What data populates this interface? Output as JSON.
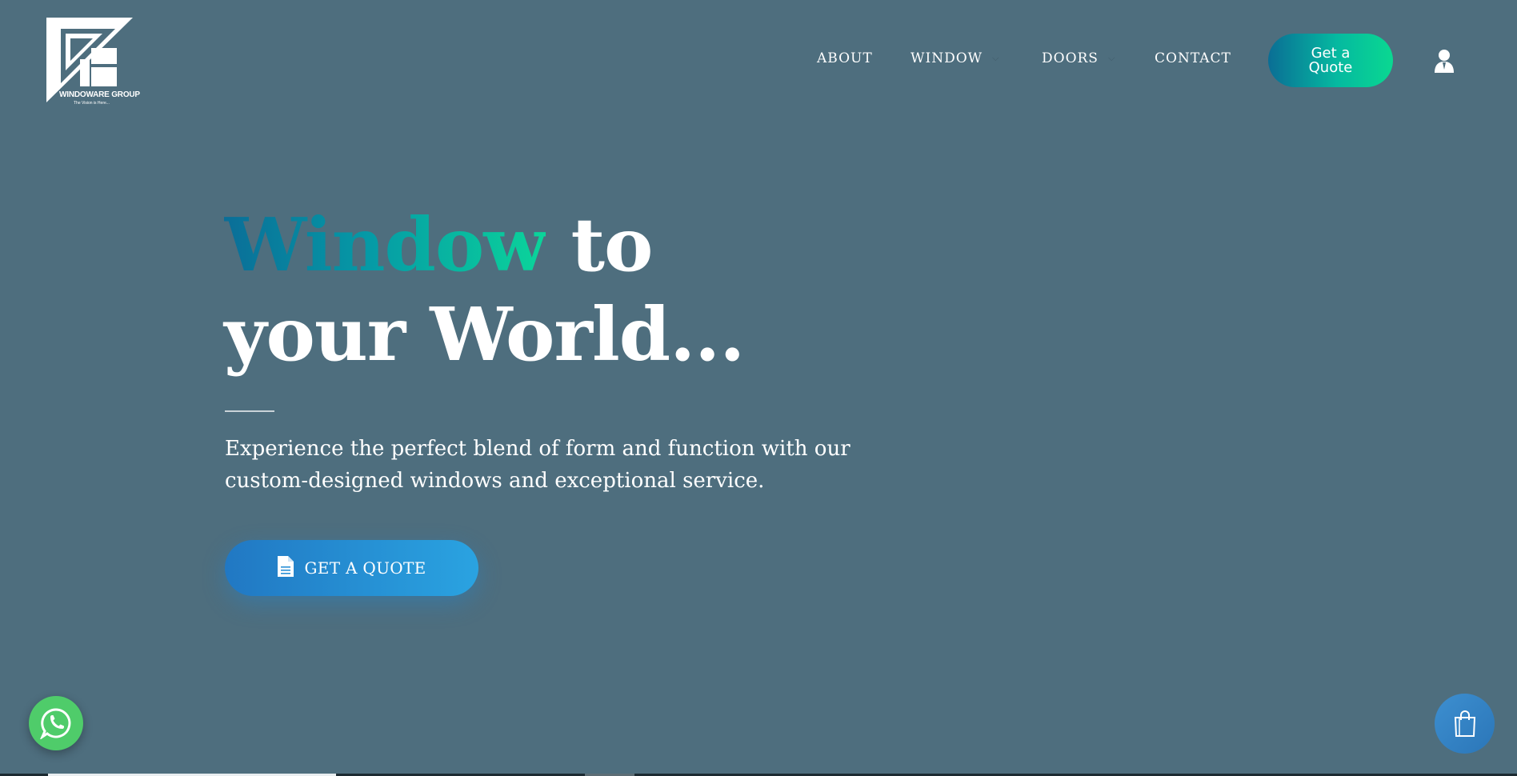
{
  "brand": {
    "name": "WINDOWARE GROUP",
    "tagline": "The Vision is Here..."
  },
  "nav": {
    "items": [
      {
        "label": "ABOUT",
        "has_dropdown": false
      },
      {
        "label": "WINDOW",
        "has_dropdown": true
      },
      {
        "label": "DOORS",
        "has_dropdown": true
      },
      {
        "label": "CONTACT",
        "has_dropdown": false
      }
    ],
    "quote_button": {
      "line1": "Get a",
      "line2": "Quote"
    },
    "user_icon": "user-icon"
  },
  "hero": {
    "title_highlight": "Window",
    "title_rest_line1": " to",
    "title_line2": "your World...",
    "subtitle": "Experience the perfect blend of form and function with our custom-designed windows and exceptional service.",
    "cta_label": "GET A QUOTE",
    "cta_icon": "document-icon"
  },
  "floating": {
    "whatsapp_icon": "whatsapp-icon",
    "cart_icon": "shopping-bag-icon"
  },
  "colors": {
    "background": "#4e6e7e",
    "accent_gradient_start": "#0a6e98",
    "accent_gradient_end": "#0bd59a",
    "cta_blue": "#2a8fd5",
    "whatsapp_green": "#4fcc6a"
  }
}
